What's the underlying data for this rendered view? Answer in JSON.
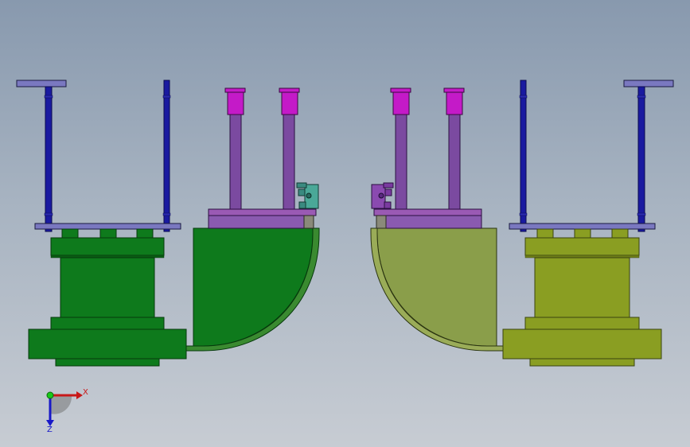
{
  "viewport": {
    "background_top": "#8899ae",
    "background_bottom": "#c7ccd3"
  },
  "colors": {
    "green_part": "#0e7a1c",
    "green_dark": "#0a5c14",
    "olive_part": "#8a9e22",
    "olive_dark": "#6e7e18",
    "olive_shell": "#8a9e4a",
    "rod_blue": "#1a1aa0",
    "plate_lavender": "#7a78c0",
    "column_purple": "#7b4aa0",
    "cap_magenta": "#c41ac8",
    "base_plate": "#9a5ab4",
    "clamp_teal": "#4aa898",
    "clamp_purple": "#8a4ab0"
  },
  "model": {
    "left_assembly": {
      "icon": "green-fixture-icon"
    },
    "right_assembly": {
      "icon": "olive-fixture-icon"
    }
  },
  "triad": {
    "x_label": "X",
    "z_label": "Z",
    "x_color": "#c81818",
    "y_color": "#18c818",
    "z_color": "#1818c8"
  }
}
